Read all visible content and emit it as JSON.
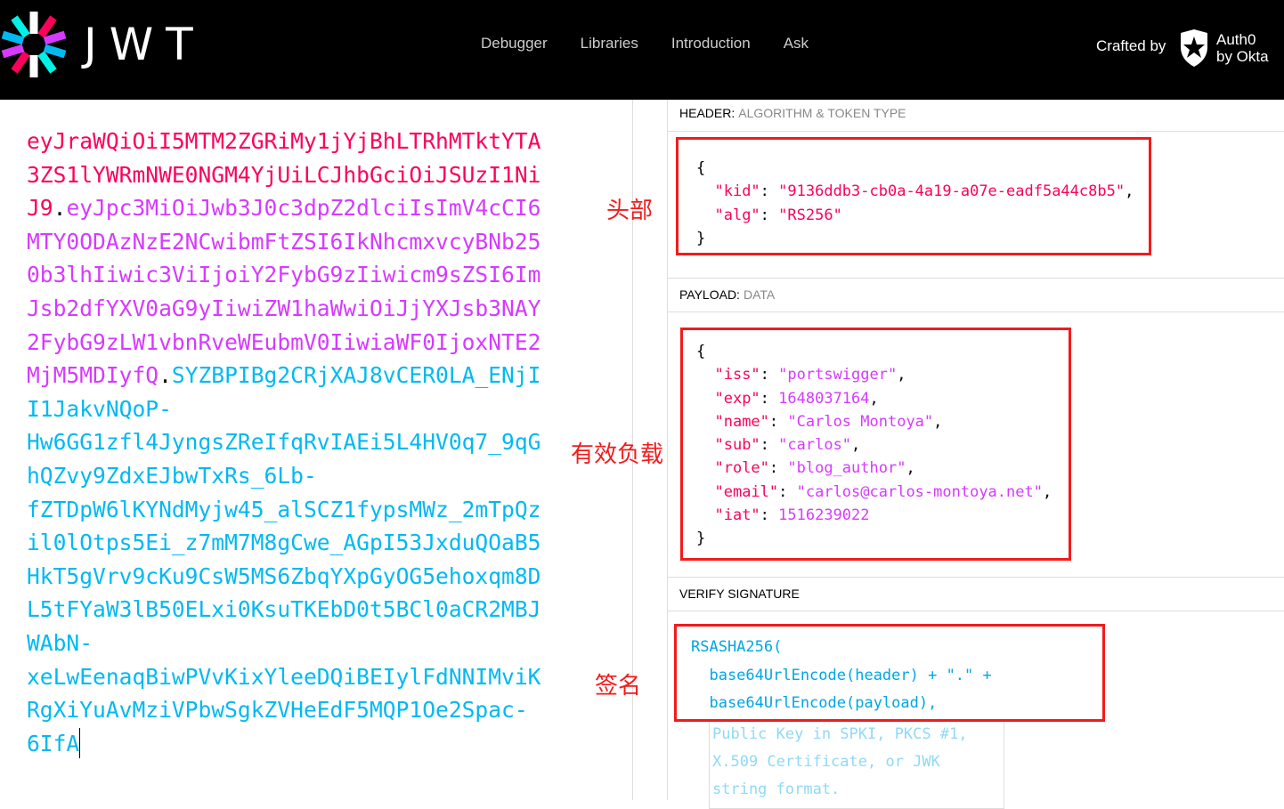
{
  "nav": {
    "brand": "JWT",
    "items": [
      "Debugger",
      "Libraries",
      "Introduction",
      "Ask"
    ],
    "crafted_by": "Crafted by",
    "auth0_line1": "Auth0",
    "auth0_line2": "by Okta"
  },
  "token": {
    "header": "eyJraWQiOiI5MTM2ZGRiMy1jYjBhLTRhMTktYTA3ZS1lYWRmNWE0NGM4YjUiLCJhbGciOiJSUzI1NiJ9",
    "dot1": ".",
    "payload": "eyJpc3MiOiJwb3J0c3dpZ2dlciIsImV4cCI6MTY0ODAzNzE2NCwibmFtZSI6IkNhcmxvcyBNb250b3lhIiwic3ViIjoiY2FybG9zIiwicm9sZSI6ImJsb2dfYXV0aG9yIiwiZW1haWwiOiJjYXJsb3NAY2FybG9zLW1vbnRveWEubmV0IiwiaWF0IjoxNTE2MjM5MDIyfQ",
    "dot2": ".",
    "signature": "SYZBPIBg2CRjXAJ8vCER0LA_ENjII1JakvNQoP-Hw6GG1zfl4JyngsZReIfqRvIAEi5L4HV0q7_9qGhQZvy9ZdxEJbwTxRs_6Lb-fZTDpW6lKYNdMyjw45_alSCZ1fypsMWz_2mTpQzil0lOtps5Ei_z7mM7M8gCwe_AGpI53JxduQOaB5HkT5gVrv9cKu9CsW5MS6ZbqYXpGyOG5ehoxqm8DL5tFYaW3lB50ELxi0KsuTKEbD0t5BCl0aCR2MBJWAbN-xeLwEenaqBiwPVvKixYleeDQiBEIylFdNNIMviKRgXiYuAvMziVPbwSgkZVHeEdF5MQP1Oe2Spac-6IfA"
  },
  "header_section": {
    "title": "HEADER:",
    "subtitle": "ALGORITHM & TOKEN TYPE",
    "open": "{",
    "close": "}",
    "fields": [
      {
        "key": "\"kid\"",
        "value": "\"9136ddb3-cb0a-4a19-a07e-eadf5a44c8b5\"",
        "sep": ","
      },
      {
        "key": "\"alg\"",
        "value": "\"RS256\"",
        "sep": ""
      }
    ]
  },
  "payload_section": {
    "title": "PAYLOAD:",
    "subtitle": "DATA",
    "open": "{",
    "close": "}",
    "fields": [
      {
        "key": "\"iss\"",
        "value": "\"portswigger\"",
        "sep": ","
      },
      {
        "key": "\"exp\"",
        "value": "1648037164",
        "sep": ","
      },
      {
        "key": "\"name\"",
        "value": "\"Carlos Montoya\"",
        "sep": ","
      },
      {
        "key": "\"sub\"",
        "value": "\"carlos\"",
        "sep": ","
      },
      {
        "key": "\"role\"",
        "value": "\"blog_author\"",
        "sep": ","
      },
      {
        "key": "\"email\"",
        "value": "\"carlos@carlos-montoya.net\"",
        "sep": ","
      },
      {
        "key": "\"iat\"",
        "value": "1516239022",
        "sep": ""
      }
    ]
  },
  "verify_section": {
    "title": "VERIFY SIGNATURE",
    "line1": "RSASHA256(",
    "line2": "  base64UrlEncode(header) + \".\" +",
    "line3": "  base64UrlEncode(payload),",
    "public_key_placeholder": "Public Key in SPKI, PKCS #1, X.509 Certificate, or JWK string format."
  },
  "annotations": {
    "header": "头部",
    "payload": "有效负载",
    "signature": "签名"
  },
  "colors": {
    "header": "#fb015b",
    "payload": "#d63aff",
    "signature": "#00b9f1",
    "annotation": "#f21b1b"
  }
}
